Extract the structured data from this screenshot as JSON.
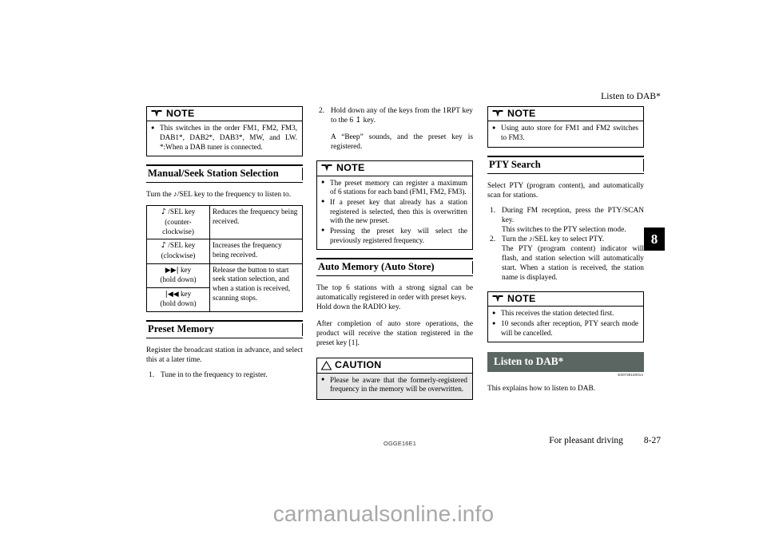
{
  "header": {
    "running_head": "Listen to DAB*"
  },
  "chapter_tab": "8",
  "columns": {
    "left": {
      "note1": {
        "title": "NOTE",
        "bullets": [
          "This switches in the order FM1, FM2, FM3, DAB1*, DAB2*, DAB3*, MW, and LW. *:When a DAB tuner is connected."
        ]
      },
      "heading_manual_seek": "Manual/Seek Station Selection",
      "intro_manual_seek": "Turn the ♪/SEL key to the frequency to listen to.",
      "table": {
        "rows": [
          {
            "key": "♪ /SEL key (counter-clockwise)",
            "key_line1": "♪ /SEL key",
            "key_line2": "(counter-",
            "key_line3": "clockwise)",
            "desc": "Reduces the frequency being received."
          },
          {
            "key": "♪ /SEL key (clockwise)",
            "key_line1": "♪ /SEL key",
            "key_line2": "(clockwise)",
            "key_line3": "",
            "desc": "Increases the frequency being received."
          },
          {
            "key": "▶▶| key (hold down)",
            "key_line1": "▶▶| key",
            "key_line2": "(hold down)",
            "key_line3": "",
            "desc": "Release the button to start seek station selection, and when a station is received, scanning stops."
          },
          {
            "key": "|◀◀ key (hold down)",
            "key_line1": "|◀◀ key",
            "key_line2": "(hold down)",
            "key_line3": "",
            "desc": ""
          }
        ]
      },
      "heading_preset_memory": "Preset Memory",
      "intro_preset_memory": "Register the broadcast station in advance, and select this at a later time.",
      "step_1_num": "1.",
      "step_1_text": "Tune in to the frequency to register."
    },
    "middle": {
      "step_2_num": "2.",
      "step_2_text": "Hold down any of the keys from the 1RPT key to the 6 ↥ key.",
      "step_2_result": "A “Beep” sounds, and the preset key is registered.",
      "note1": {
        "title": "NOTE",
        "bullets": [
          "The preset memory can register a maximum of 6 stations for each band (FM1, FM2, FM3).",
          "If a preset key that already has a station registered is selected, then this is overwritten with the new preset.",
          "Pressing the preset key will select the previously registered frequency."
        ]
      },
      "heading_auto_memory": "Auto Memory (Auto Store)",
      "auto_memory_para1": "The top 6 stations with a strong signal can be automatically registered in order with preset keys.",
      "auto_memory_para2": "Hold down the RADIO key.",
      "auto_memory_para3": "After completion of auto store operations, the product will receive the station registered in the preset key [1].",
      "caution": {
        "title": "CAUTION",
        "bullets": [
          "Please be aware that the formerly-registered frequency in the memory will be overwritten."
        ]
      }
    },
    "right": {
      "note1": {
        "title": "NOTE",
        "bullets": [
          "Using auto store for FM1 and FM2 switches to FM3."
        ]
      },
      "heading_pty_search": "PTY Search",
      "pty_intro": "Select PTY (program content), and automatically scan for stations.",
      "pty_step1_num": "1.",
      "pty_step1_text": "During FM reception, press the PTY/SCAN key.",
      "pty_step1_sub": "This switches to the PTY selection mode.",
      "pty_step2_num": "2.",
      "pty_step2_text": "Turn the ♪/SEL key to select PTY.",
      "pty_step2_sub": "The PTY (program content) indicator will flash, and station selection will automatically start. When a station is received, the station name is displayed.",
      "note2": {
        "title": "NOTE",
        "bullets": [
          "This receives the station detected first.",
          "10 seconds after reception, PTY search mode will be cancelled."
        ]
      },
      "band_heading": "Listen to DAB*",
      "band_code": "E00739100014",
      "band_para": "This explains how to listen to DAB."
    }
  },
  "footer": {
    "doc_code": "OGGE16E1",
    "section_title": "For pleasant driving",
    "page_number": "8-27"
  },
  "watermark": "carmanualsonline.info",
  "colors": {
    "band_background": "#5b6663",
    "caution_background": "#e8e8e8",
    "tab_background": "#000000",
    "watermark_color": "#a8a8a8"
  }
}
